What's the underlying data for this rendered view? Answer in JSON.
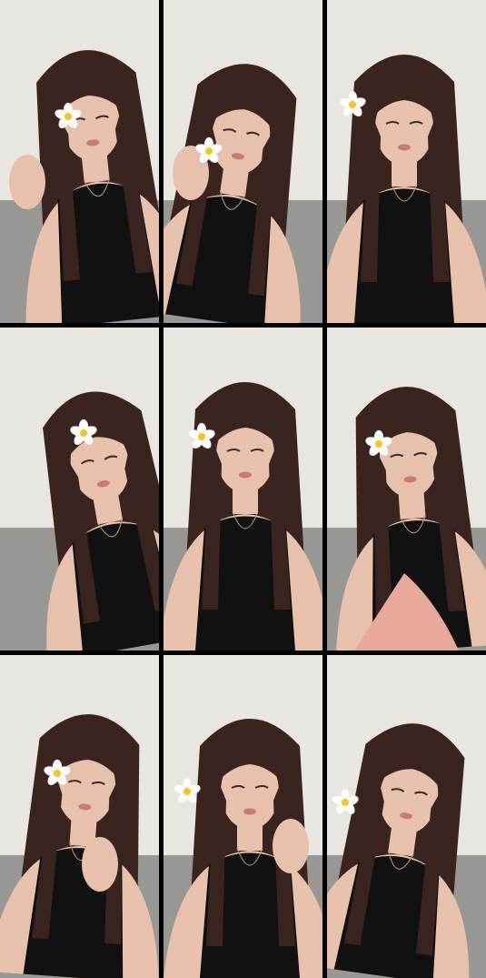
{
  "frames": [
    {
      "id": "frame-1",
      "flower": "white-flower-icon",
      "scene": "left-hand-near-face"
    },
    {
      "id": "frame-2",
      "flower": "white-flower-icon",
      "scene": "hand-in-hair"
    },
    {
      "id": "frame-3",
      "flower": "white-flower-icon",
      "scene": "eyes-closed"
    },
    {
      "id": "frame-4",
      "flower": "white-flower-icon",
      "scene": "speaking-head-tilt"
    },
    {
      "id": "frame-5",
      "flower": "white-flower-icon",
      "scene": "facing-camera"
    },
    {
      "id": "frame-6",
      "flower": "white-flower-icon",
      "scene": "holding-pink-pillow"
    },
    {
      "id": "frame-7",
      "flower": "white-flower-icon",
      "scene": "hands-clasped"
    },
    {
      "id": "frame-8",
      "flower": "white-flower-icon",
      "scene": "hand-at-neck"
    },
    {
      "id": "frame-9",
      "flower": "white-flower-icon",
      "scene": "looking-down"
    }
  ],
  "colors": {
    "background_wall": "#e9e5e0",
    "hair": "#3a2420",
    "skin": "#e8c1ac",
    "top": "#111111",
    "flower_petal": "#ffffff",
    "flower_center": "#f3c623",
    "pillow": "#e9a99a"
  }
}
